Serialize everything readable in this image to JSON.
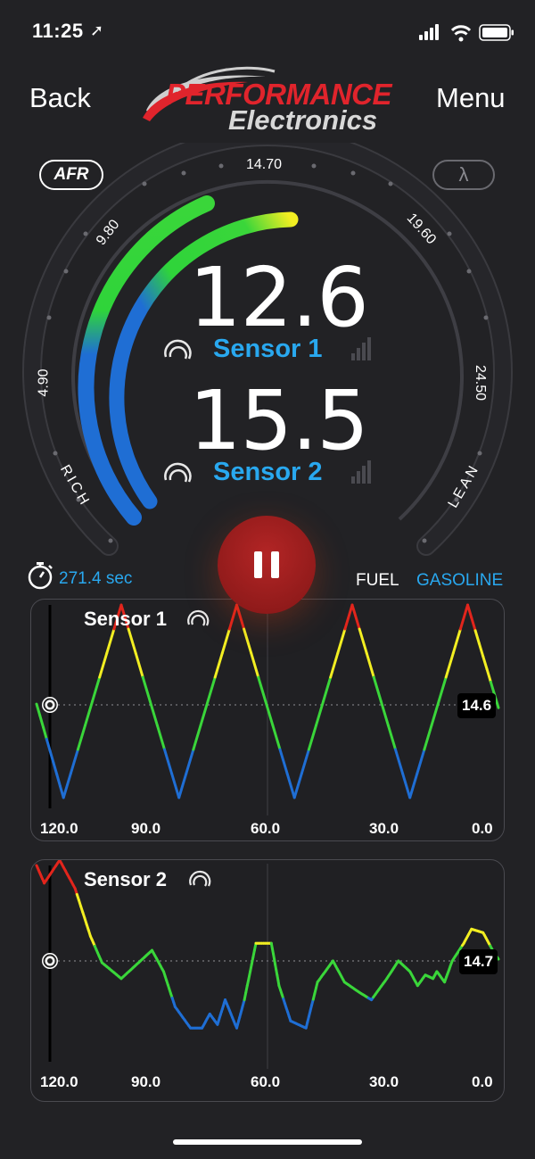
{
  "status_bar": {
    "time": "11:25",
    "location_icon": "location-arrow-icon"
  },
  "header": {
    "back_label": "Back",
    "menu_label": "Menu",
    "logo_top": "PERFORMANCE",
    "logo_bottom": "Electronics"
  },
  "modes": {
    "afr_label": "AFR",
    "lambda_label": "λ"
  },
  "gauge": {
    "scale_labels": [
      "4.90",
      "9.80",
      "14.70",
      "19.60",
      "24.50"
    ],
    "rich_label": "RICH",
    "lean_label": "LEAN",
    "sensors": [
      {
        "name": "Sensor 1",
        "value": "12.6"
      },
      {
        "name": "Sensor 2",
        "value": "15.5"
      }
    ]
  },
  "session": {
    "elapsed": "271.4 sec",
    "fuel_label": "FUEL",
    "fuel_type": "GASOLINE"
  },
  "colors": {
    "accent_blue": "#29a8ef",
    "pause_red": "#9c1d1d",
    "rich_blue": "#1f6ed4",
    "ok_green": "#3ad63a",
    "warn_yellow": "#f2ee22",
    "lean_red": "#e2251c"
  },
  "chart_data": [
    {
      "type": "line",
      "title": "Sensor 1",
      "x_tick_labels": [
        "120.0",
        "90.0",
        "60.0",
        "30.0",
        "0.0"
      ],
      "current_value": "14.6",
      "x": [
        120,
        113,
        98,
        83,
        68,
        53,
        38,
        23,
        8,
        0
      ],
      "y": [
        14.6,
        9.5,
        20.0,
        9.5,
        20.0,
        9.5,
        20.0,
        9.5,
        20.0,
        14.4
      ]
    },
    {
      "type": "line",
      "title": "Sensor 2",
      "x_tick_labels": [
        "120.0",
        "90.0",
        "60.0",
        "30.0",
        "0.0"
      ],
      "current_value": "14.7",
      "x": [
        120,
        118,
        114,
        110,
        106,
        103,
        98,
        94,
        90,
        87,
        84,
        80,
        77,
        75,
        73,
        71,
        68,
        66,
        63,
        59,
        57,
        54,
        50,
        47,
        43,
        40,
        36,
        33,
        29,
        26,
        23,
        21,
        19,
        17,
        16,
        14,
        12,
        9,
        7,
        4,
        1,
        0
      ],
      "y": [
        20.0,
        19.0,
        20.3,
        18.7,
        16.0,
        14.5,
        13.6,
        14.4,
        15.2,
        14.0,
        12.0,
        10.8,
        10.8,
        11.6,
        11.0,
        12.4,
        10.8,
        12.4,
        15.6,
        15.6,
        13.2,
        11.2,
        10.8,
        13.4,
        14.6,
        13.4,
        12.8,
        12.4,
        13.6,
        14.6,
        14.0,
        13.2,
        13.8,
        13.6,
        14.0,
        13.4,
        14.6,
        15.6,
        16.4,
        16.2,
        15.0,
        14.7
      ]
    }
  ]
}
